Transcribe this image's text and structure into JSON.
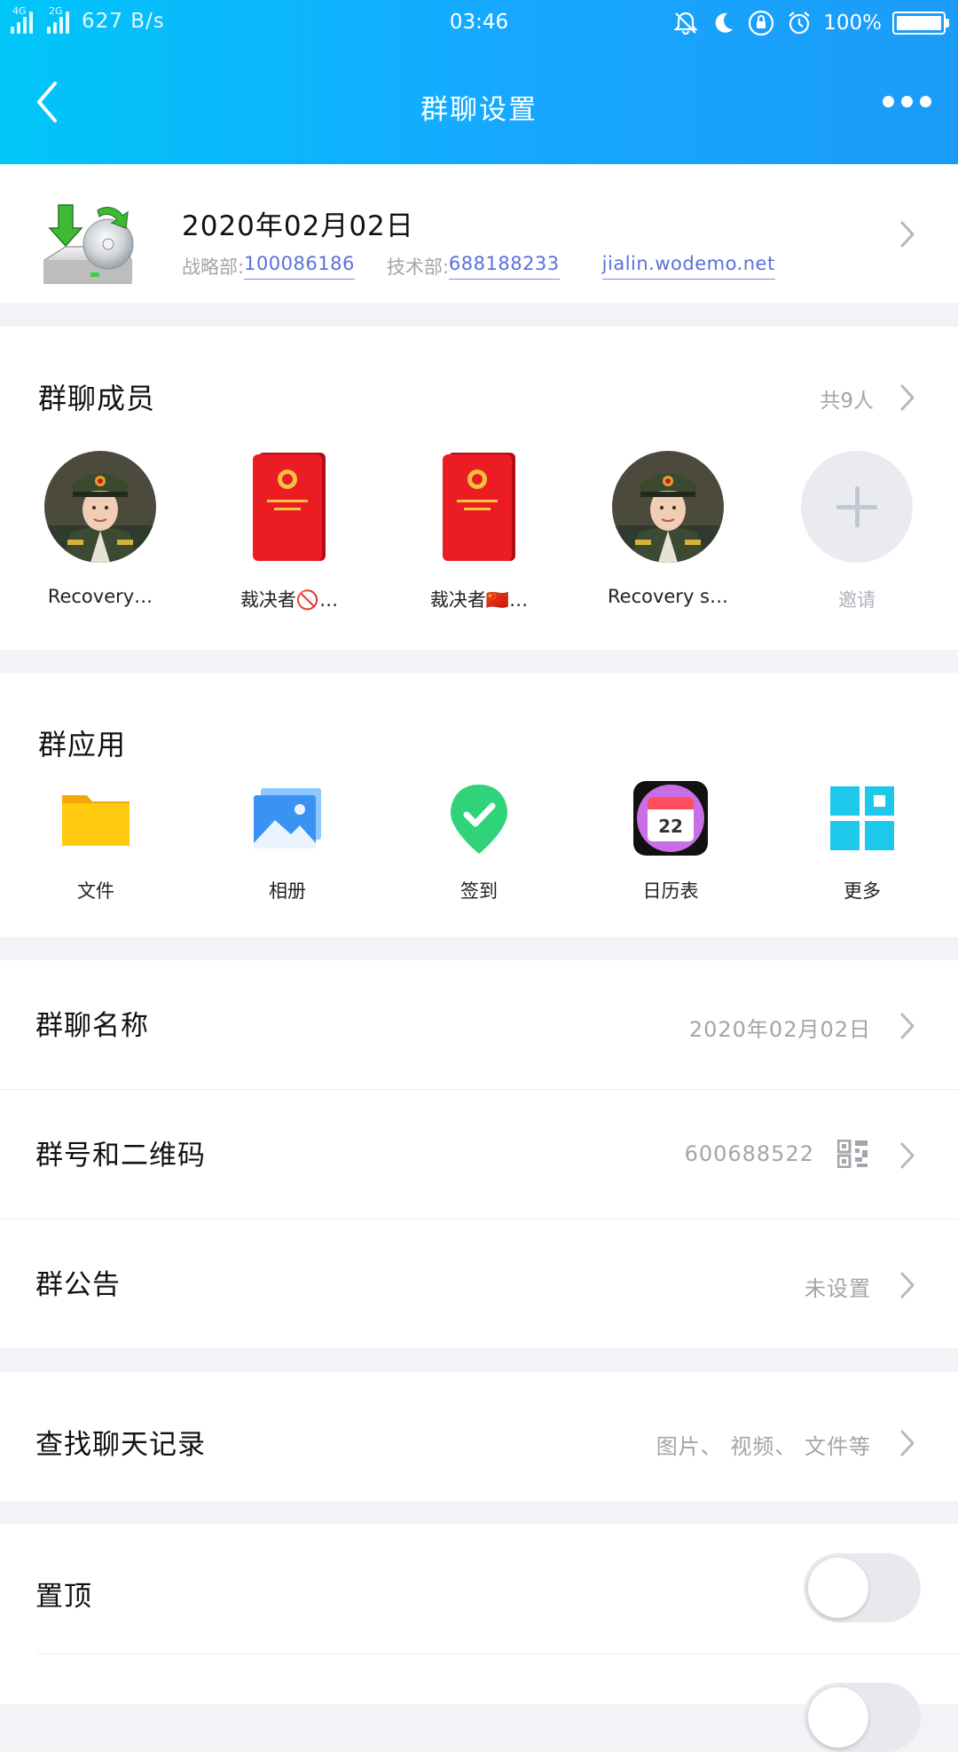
{
  "status_bar": {
    "net1": "4G",
    "net2": "2G",
    "speed": "627 B/s",
    "time": "03:46",
    "battery": "100%"
  },
  "nav": {
    "title": "群聊设置"
  },
  "group_info": {
    "name": "2020年02月02日",
    "dept1_label": "战略部:",
    "dept1_value": "100086186",
    "dept2_label": "技术部:",
    "dept2_value": "688188233",
    "link": "jialin.wodemo.net"
  },
  "members": {
    "title": "群聊成员",
    "count": "共9人",
    "items": [
      {
        "name": "Recovery…"
      },
      {
        "name": "裁决者🚫…"
      },
      {
        "name": "裁决者🇨🇳…"
      },
      {
        "name": "Recovery  s…"
      }
    ],
    "invite_label": "邀请"
  },
  "apps": {
    "title": "群应用",
    "items": [
      {
        "label": "文件",
        "icon": "folder-icon"
      },
      {
        "label": "相册",
        "icon": "photo-album-icon"
      },
      {
        "label": "签到",
        "icon": "check-in-icon"
      },
      {
        "label": "日历表",
        "icon": "calendar-icon",
        "day": "22"
      },
      {
        "label": "更多",
        "icon": "more-apps-icon"
      }
    ]
  },
  "settings": {
    "name": {
      "label": "群聊名称",
      "value": "2020年02月02日"
    },
    "qr": {
      "label": "群号和二维码",
      "value": "600688522"
    },
    "notice": {
      "label": "群公告",
      "value": "未设置"
    },
    "history": {
      "label": "查找聊天记录",
      "value": "图片、 视频、 文件等"
    },
    "pin": {
      "label": "置顶",
      "on": false
    }
  },
  "colors": {
    "header_start": "#00c6f8",
    "header_end": "#1a9cf8",
    "link": "#5b6fde",
    "muted": "#a4a4ab"
  }
}
